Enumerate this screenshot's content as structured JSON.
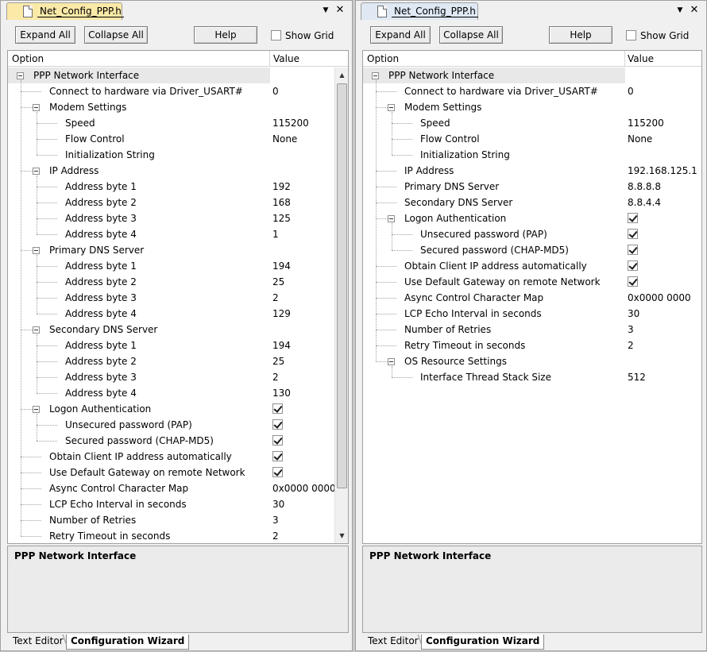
{
  "panels": [
    {
      "tab_title": "Net_Config_PPP.h",
      "toolbar": {
        "expand": "Expand All",
        "collapse": "Collapse All",
        "help": "Help",
        "show_grid": "Show Grid",
        "show_grid_checked": false
      },
      "columns": {
        "option": "Option",
        "value": "Value"
      },
      "description_title": "PPP Network Interface",
      "bottom_tabs": [
        "Text Editor",
        "Configuration Wizard"
      ],
      "rows": [
        {
          "label": "PPP Network Interface",
          "value": ""
        },
        {
          "label": "Connect to hardware via Driver_USART#",
          "value": "0"
        },
        {
          "label": "Modem Settings",
          "value": ""
        },
        {
          "label": "Speed",
          "value": "115200"
        },
        {
          "label": "Flow Control",
          "value": "None"
        },
        {
          "label": "Initialization String",
          "value": ""
        },
        {
          "label": "IP Address",
          "value": ""
        },
        {
          "label": "Address byte 1",
          "value": "192"
        },
        {
          "label": "Address byte 2",
          "value": "168"
        },
        {
          "label": "Address byte 3",
          "value": "125"
        },
        {
          "label": "Address byte 4",
          "value": "1"
        },
        {
          "label": "Primary DNS Server",
          "value": ""
        },
        {
          "label": "Address byte 1",
          "value": "194"
        },
        {
          "label": "Address byte 2",
          "value": "25"
        },
        {
          "label": "Address byte 3",
          "value": "2"
        },
        {
          "label": "Address byte 4",
          "value": "129"
        },
        {
          "label": "Secondary DNS Server",
          "value": ""
        },
        {
          "label": "Address byte 1",
          "value": "194"
        },
        {
          "label": "Address byte 2",
          "value": "25"
        },
        {
          "label": "Address byte 3",
          "value": "2"
        },
        {
          "label": "Address byte 4",
          "value": "130"
        },
        {
          "label": "Logon Authentication",
          "checked": true
        },
        {
          "label": "Unsecured password (PAP)",
          "checked": true
        },
        {
          "label": "Secured password (CHAP-MD5)",
          "checked": true
        },
        {
          "label": "Obtain Client IP address automatically",
          "checked": true
        },
        {
          "label": "Use Default Gateway on remote Network",
          "checked": true
        },
        {
          "label": "Async Control Character Map",
          "value": "0x0000 0000"
        },
        {
          "label": "LCP Echo Interval in seconds",
          "value": "30"
        },
        {
          "label": "Number of Retries",
          "value": "3"
        },
        {
          "label": "Retry Timeout in seconds",
          "value": "2"
        }
      ]
    },
    {
      "tab_title": "Net_Config_PPP.h",
      "toolbar": {
        "expand": "Expand All",
        "collapse": "Collapse All",
        "help": "Help",
        "show_grid": "Show Grid",
        "show_grid_checked": false
      },
      "columns": {
        "option": "Option",
        "value": "Value"
      },
      "description_title": "PPP Network Interface",
      "bottom_tabs": [
        "Text Editor",
        "Configuration Wizard"
      ],
      "rows": [
        {
          "label": "PPP Network Interface",
          "value": ""
        },
        {
          "label": "Connect to hardware via Driver_USART#",
          "value": "0"
        },
        {
          "label": "Modem Settings",
          "value": ""
        },
        {
          "label": "Speed",
          "value": "115200"
        },
        {
          "label": "Flow Control",
          "value": "None"
        },
        {
          "label": "Initialization String",
          "value": ""
        },
        {
          "label": "IP Address",
          "value": "192.168.125.1"
        },
        {
          "label": "Primary DNS Server",
          "value": "8.8.8.8"
        },
        {
          "label": "Secondary DNS Server",
          "value": "8.8.4.4"
        },
        {
          "label": "Logon Authentication",
          "checked": true
        },
        {
          "label": "Unsecured password (PAP)",
          "checked": true
        },
        {
          "label": "Secured password (CHAP-MD5)",
          "checked": true
        },
        {
          "label": "Obtain Client IP address automatically",
          "checked": true
        },
        {
          "label": "Use Default Gateway on remote Network",
          "checked": true
        },
        {
          "label": "Async Control Character Map",
          "value": "0x0000 0000"
        },
        {
          "label": "LCP Echo Interval in seconds",
          "value": "30"
        },
        {
          "label": "Number of Retries",
          "value": "3"
        },
        {
          "label": "Retry Timeout in seconds",
          "value": "2"
        },
        {
          "label": "OS Resource Settings",
          "value": ""
        },
        {
          "label": "Interface Thread Stack Size",
          "value": "512"
        }
      ]
    }
  ]
}
